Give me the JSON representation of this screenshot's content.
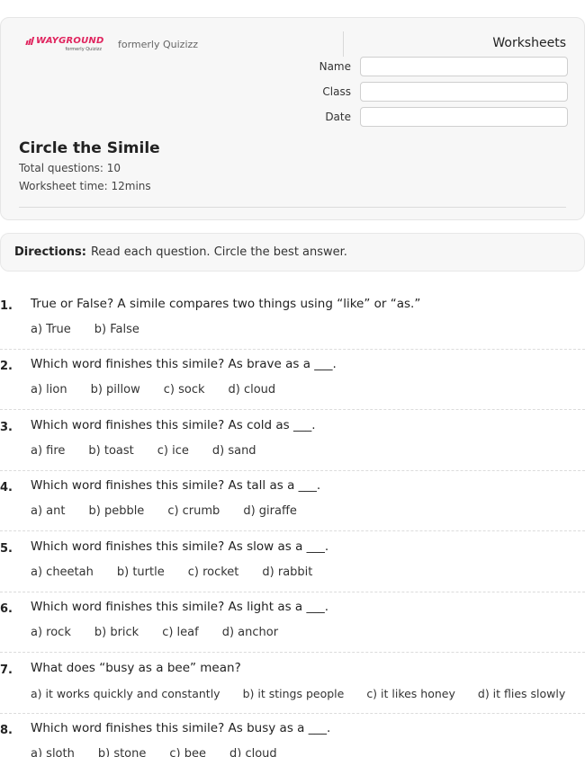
{
  "header": {
    "logo_text": "WAYGROUND",
    "logo_sub": "formerly Quizizz",
    "formerly": "formerly Quizizz",
    "worksheets_label": "Worksheets",
    "fields": [
      {
        "label": "Name",
        "value": ""
      },
      {
        "label": "Class",
        "value": ""
      },
      {
        "label": "Date",
        "value": ""
      }
    ],
    "title": "Circle the Simile",
    "total_questions": "Total questions: 10",
    "worksheet_time": "Worksheet time: 12mins"
  },
  "directions": {
    "label": "Directions:",
    "text": "Read each question. Circle the best answer."
  },
  "questions": [
    {
      "num": "1.",
      "text": "True or False? A simile compares two things using “like” or “as.”",
      "options": [
        "a) True",
        "b) False"
      ]
    },
    {
      "num": "2.",
      "text": "Which word finishes this simile? As brave as a ___.",
      "options": [
        "a) lion",
        "b) pillow",
        "c) sock",
        "d) cloud"
      ]
    },
    {
      "num": "3.",
      "text": "Which word finishes this simile? As cold as ___.",
      "options": [
        "a) fire",
        "b) toast",
        "c) ice",
        "d) sand"
      ]
    },
    {
      "num": "4.",
      "text": "Which word finishes this simile? As tall as a ___.",
      "options": [
        "a) ant",
        "b) pebble",
        "c) crumb",
        "d) giraffe"
      ]
    },
    {
      "num": "5.",
      "text": "Which word finishes this simile? As slow as a ___.",
      "options": [
        "a) cheetah",
        "b) turtle",
        "c) rocket",
        "d) rabbit"
      ]
    },
    {
      "num": "6.",
      "text": "Which word finishes this simile? As light as a ___.",
      "options": [
        "a) rock",
        "b) brick",
        "c) leaf",
        "d) anchor"
      ]
    },
    {
      "num": "7.",
      "text": "What does “busy as a bee” mean?",
      "options": [
        "a) it works quickly and constantly",
        "b) it stings people",
        "c) it likes honey",
        "d) it flies slowly"
      ]
    },
    {
      "num": "8.",
      "text": "Which word finishes this simile? As busy as a ___.",
      "options": [
        "a) sloth",
        "b) stone",
        "c) bee",
        "d) cloud"
      ]
    }
  ]
}
